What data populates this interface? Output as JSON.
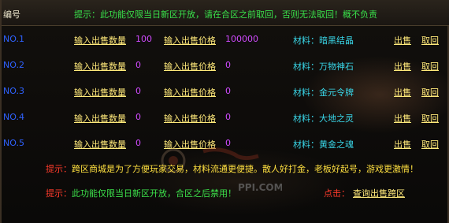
{
  "header": {
    "label": "编号",
    "tip": "提示：此功能仅限当日新区开放，请在合区之前取回，否则无法取回！概不负责"
  },
  "rows": [
    {
      "no": "NO.1",
      "qty_label": "输入出售数量",
      "qty": "100",
      "price_label": "输入出售价格",
      "price": "100000",
      "material": "材料：暗黑结晶",
      "sell": "出售",
      "retrieve": "取回"
    },
    {
      "no": "NO.2",
      "qty_label": "输入出售数量",
      "qty": "0",
      "price_label": "输入出售价格",
      "price": "0",
      "material": "材料：万物神石",
      "sell": "出售",
      "retrieve": "取回"
    },
    {
      "no": "NO.3",
      "qty_label": "输入出售数量",
      "qty": "0",
      "price_label": "输入出售价格",
      "price": "0",
      "material": "材料：金元令牌",
      "sell": "出售",
      "retrieve": "取回"
    },
    {
      "no": "NO.4",
      "qty_label": "输入出售数量",
      "qty": "0",
      "price_label": "输入出售价格",
      "price": "0",
      "material": "材料：大地之灵",
      "sell": "出售",
      "retrieve": "取回"
    },
    {
      "no": "NO.5",
      "qty_label": "输入出售数量",
      "qty": "0",
      "price_label": "输入出售价格",
      "price": "0",
      "material": "材料：黄金之魂",
      "sell": "出售",
      "retrieve": "取回"
    }
  ],
  "footer": {
    "tip1_prefix": "提示：",
    "tip1_text": "跨区商城是为了方便玩家交易，材料流通更便捷。散人好打金，老板好起号，游戏更激情！",
    "tip2_prefix": "提示：",
    "tip2_text": "此功能仅限当日新区开放，合区之后禁用！",
    "click_label": "点击：",
    "query_link": "查询出售跨区"
  },
  "watermark_text": "PPI.COM",
  "colors": {
    "accent_yellow": "#ffe97a",
    "magenta_value": "#d14bff",
    "cyan_material": "#39d6e8",
    "green_tip": "#39e04a",
    "red_prefix": "#ff3b2b",
    "blue_no": "#2f62ff"
  }
}
